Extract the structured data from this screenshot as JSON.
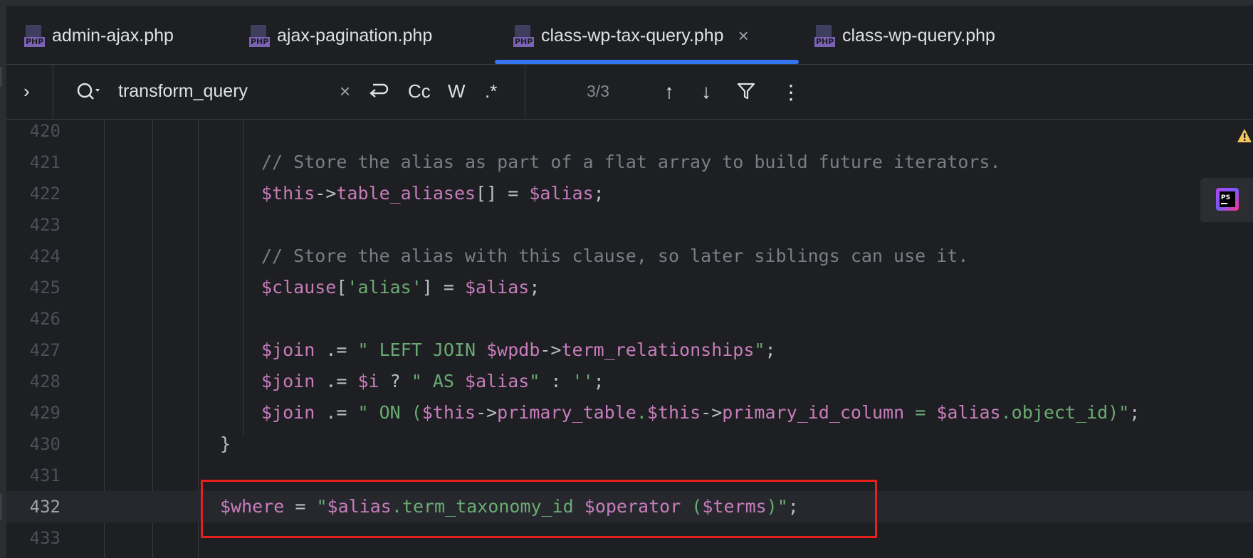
{
  "tabs": [
    {
      "label": "admin-ajax.php",
      "icon": "php-file-icon",
      "active": false
    },
    {
      "label": "ajax-pagination.php",
      "icon": "php-file-icon",
      "active": false
    },
    {
      "label": "class-wp-tax-query.php",
      "icon": "php-file-icon",
      "active": true
    },
    {
      "label": "class-wp-query.php",
      "icon": "php-file-icon",
      "active": false
    }
  ],
  "file_icon_label": "PHP",
  "tab_close_glyph": "×",
  "search": {
    "query": "transform_query",
    "clear_glyph": "×",
    "match_case_label": "Cc",
    "words_label": "W",
    "regex_label": ".*",
    "result_count": "3/3",
    "prev_glyph": "↑",
    "next_glyph": "↓",
    "more_glyph": "⋮",
    "expand_glyph": "›"
  },
  "editor": {
    "current_line": 432,
    "lines": [
      {
        "num": "420",
        "tokens": []
      },
      {
        "num": "421",
        "tokens": [
          [
            "// Store the alias as part of a flat array to build future iterators.",
            "com"
          ]
        ]
      },
      {
        "num": "422",
        "tokens": [
          [
            "$this",
            "var"
          ],
          [
            "->",
            "op"
          ],
          [
            "table_aliases",
            "prop"
          ],
          [
            "[] = ",
            "op"
          ],
          [
            "$alias",
            "var"
          ],
          [
            ";",
            "op"
          ]
        ]
      },
      {
        "num": "423",
        "tokens": []
      },
      {
        "num": "424",
        "tokens": [
          [
            "// Store the alias with this clause, so later siblings can use it.",
            "com"
          ]
        ]
      },
      {
        "num": "425",
        "tokens": [
          [
            "$clause",
            "var"
          ],
          [
            "[",
            "op"
          ],
          [
            "'alias'",
            "str"
          ],
          [
            "] = ",
            "op"
          ],
          [
            "$alias",
            "var"
          ],
          [
            ";",
            "op"
          ]
        ]
      },
      {
        "num": "426",
        "tokens": []
      },
      {
        "num": "427",
        "tokens": [
          [
            "$join",
            "var"
          ],
          [
            " .= ",
            "op"
          ],
          [
            "\" LEFT JOIN ",
            "str"
          ],
          [
            "$wpdb",
            "var"
          ],
          [
            "->",
            "op"
          ],
          [
            "term_relationships",
            "prop"
          ],
          [
            "\"",
            "str"
          ],
          [
            ";",
            "op"
          ]
        ]
      },
      {
        "num": "428",
        "tokens": [
          [
            "$join",
            "var"
          ],
          [
            " .= ",
            "op"
          ],
          [
            "$i",
            "var"
          ],
          [
            " ? ",
            "op"
          ],
          [
            "\" AS ",
            "str"
          ],
          [
            "$alias",
            "var"
          ],
          [
            "\"",
            "str"
          ],
          [
            " : ",
            "op"
          ],
          [
            "''",
            "str"
          ],
          [
            ";",
            "op"
          ]
        ]
      },
      {
        "num": "429",
        "tokens": [
          [
            "$join",
            "var"
          ],
          [
            " .= ",
            "op"
          ],
          [
            "\" ON (",
            "str"
          ],
          [
            "$this",
            "var"
          ],
          [
            "->",
            "op"
          ],
          [
            "primary_table",
            "prop"
          ],
          [
            ".",
            "str"
          ],
          [
            "$this",
            "var"
          ],
          [
            "->",
            "op"
          ],
          [
            "primary_id_column",
            "prop"
          ],
          [
            " = ",
            "str"
          ],
          [
            "$alias",
            "var"
          ],
          [
            ".object_id)\"",
            "str"
          ],
          [
            ";",
            "op"
          ]
        ]
      },
      {
        "num": "430",
        "tokens": [
          [
            "}",
            "brk"
          ]
        ]
      },
      {
        "num": "431",
        "tokens": []
      },
      {
        "num": "432",
        "tokens": [
          [
            "$where",
            "var"
          ],
          [
            " = ",
            "op"
          ],
          [
            "\"",
            "str"
          ],
          [
            "$alias",
            "var"
          ],
          [
            ".term_taxonomy_id ",
            "str"
          ],
          [
            "$operator",
            "var"
          ],
          [
            " (",
            "str"
          ],
          [
            "$terms",
            "var"
          ],
          [
            ")\"",
            "str"
          ],
          [
            ";",
            "op"
          ]
        ]
      },
      {
        "num": "433",
        "tokens": []
      }
    ]
  },
  "colors": {
    "accent": "#3574f0",
    "highlight_box": "#e5211f",
    "variable": "#c77dbb",
    "string": "#6aab73",
    "comment": "#7a7e85"
  }
}
